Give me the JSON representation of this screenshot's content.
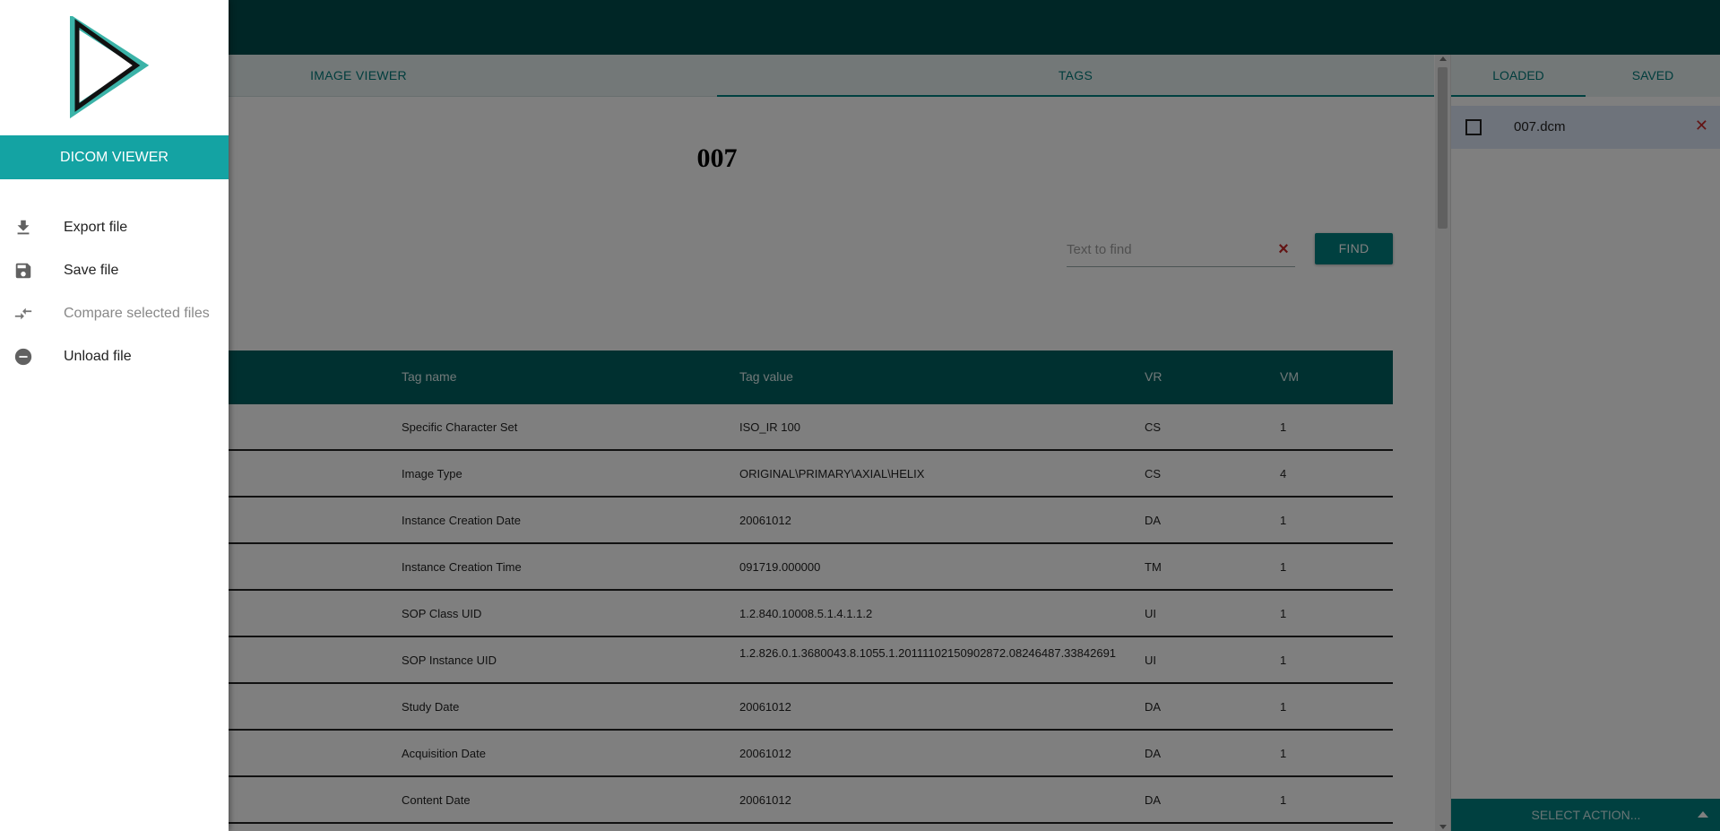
{
  "drawer": {
    "title": "DICOM VIEWER",
    "logo_icon": "play-triangle-logo",
    "menu": [
      {
        "label": "Export file",
        "icon": "download-icon",
        "enabled": true
      },
      {
        "label": "Save file",
        "icon": "floppy-disk-icon",
        "enabled": true
      },
      {
        "label": "Compare selected files",
        "icon": "compare-arrows-icon",
        "enabled": false
      },
      {
        "label": "Unload file",
        "icon": "remove-circle-icon",
        "enabled": true
      }
    ]
  },
  "main": {
    "tabs": [
      {
        "label": "IMAGE VIEWER",
        "active": false
      },
      {
        "label": "TAGS",
        "active": true
      }
    ],
    "file_title": "007",
    "search": {
      "placeholder": "Text to find",
      "value": ""
    },
    "find_label": "FIND",
    "table": {
      "headers": [
        "Tag name",
        "Tag value",
        "VR",
        "VM"
      ],
      "rows": [
        {
          "name": "Specific Character Set",
          "value": "ISO_IR 100",
          "vr": "CS",
          "vm": "1"
        },
        {
          "name": "Image Type",
          "value": "ORIGINAL\\PRIMARY\\AXIAL\\HELIX",
          "vr": "CS",
          "vm": "4"
        },
        {
          "name": "Instance Creation Date",
          "value": "20061012",
          "vr": "DA",
          "vm": "1"
        },
        {
          "name": "Instance Creation Time",
          "value": "091719.000000",
          "vr": "TM",
          "vm": "1"
        },
        {
          "name": "SOP Class UID",
          "value": "1.2.840.10008.5.1.4.1.1.2",
          "vr": "UI",
          "vm": "1"
        },
        {
          "name": "SOP Instance UID",
          "value": "1.2.826.0.1.3680043.8.1055.1.20111102150902872.08246487.33842691",
          "vr": "UI",
          "vm": "1"
        },
        {
          "name": "Study Date",
          "value": "20061012",
          "vr": "DA",
          "vm": "1"
        },
        {
          "name": "Acquisition Date",
          "value": "20061012",
          "vr": "DA",
          "vm": "1"
        },
        {
          "name": "Content Date",
          "value": "20061012",
          "vr": "DA",
          "vm": "1"
        }
      ]
    }
  },
  "right_panel": {
    "tabs": [
      {
        "label": "LOADED",
        "active": true
      },
      {
        "label": "SAVED",
        "active": false
      }
    ],
    "files": [
      {
        "name": "007.dcm",
        "checked": false
      }
    ],
    "select_action_label": "SELECT ACTION..."
  },
  "colors": {
    "topbar": "#004d4d",
    "accent": "#008080",
    "drawer_header": "#14a3a3",
    "remove": "#c62828"
  }
}
